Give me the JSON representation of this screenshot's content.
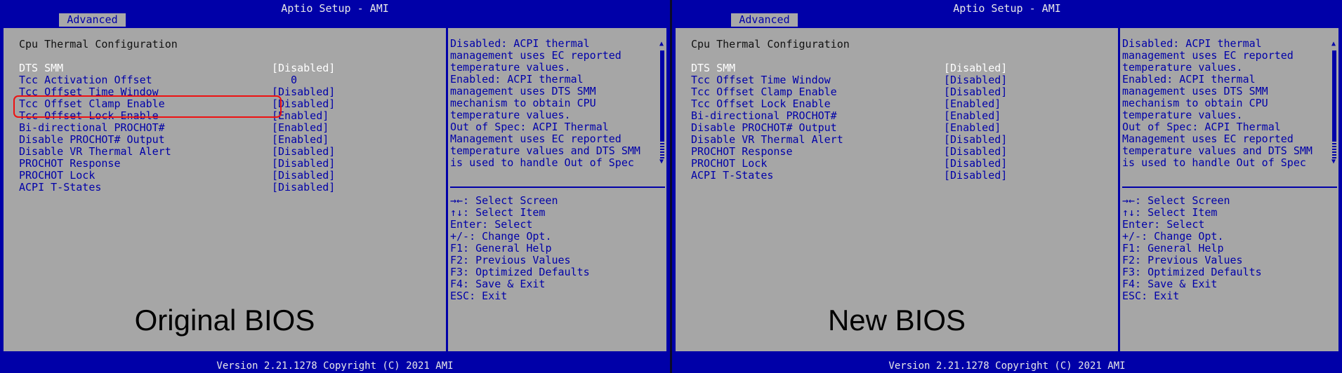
{
  "title": "Aptio Setup - AMI",
  "tab": "Advanced",
  "heading": "Cpu Thermal Configuration",
  "footer": "Version 2.21.1278 Copyright (C) 2021 AMI",
  "help": [
    "Disabled: ACPI thermal",
    "management uses EC reported",
    "temperature values.",
    "Enabled: ACPI thermal",
    "management uses DTS SMM",
    "mechanism to obtain CPU",
    "temperature values.",
    "Out of Spec: ACPI Thermal",
    "Management uses EC reported",
    "temperature values and DTS SMM",
    "is used to handle Out of Spec"
  ],
  "keys": [
    "→←: Select Screen",
    "↑↓: Select Item",
    "Enter: Select",
    "+/-: Change Opt.",
    "F1: General Help",
    "F2: Previous Values",
    "F3: Optimized Defaults",
    "F4: Save & Exit",
    "ESC: Exit"
  ],
  "left": {
    "caption": "Original BIOS",
    "rows": [
      {
        "label": "DTS SMM",
        "value": "[Disabled]"
      },
      {
        "label": "Tcc Activation Offset",
        "value": "0"
      },
      {
        "label": "Tcc Offset Time Window",
        "value": "[Disabled]"
      },
      {
        "label": "Tcc Offset Clamp Enable",
        "value": "[Disabled]"
      },
      {
        "label": "Tcc Offset Lock Enable",
        "value": "[Enabled]"
      },
      {
        "label": "Bi-directional PROCHOT#",
        "value": "[Enabled]"
      },
      {
        "label": "Disable PROCHOT# Output",
        "value": "[Enabled]"
      },
      {
        "label": "Disable VR Thermal Alert",
        "value": "[Disabled]"
      },
      {
        "label": "PROCHOT Response",
        "value": "[Disabled]"
      },
      {
        "label": "PROCHOT Lock",
        "value": "[Disabled]"
      },
      {
        "label": "ACPI T-States",
        "value": "[Disabled]"
      }
    ]
  },
  "right": {
    "caption": "New BIOS",
    "rows": [
      {
        "label": "DTS SMM",
        "value": "[Disabled]"
      },
      {
        "label": "Tcc Offset Time Window",
        "value": "[Disabled]"
      },
      {
        "label": "Tcc Offset Clamp Enable",
        "value": "[Disabled]"
      },
      {
        "label": "Tcc Offset Lock Enable",
        "value": "[Enabled]"
      },
      {
        "label": "Bi-directional PROCHOT#",
        "value": "[Enabled]"
      },
      {
        "label": "Disable PROCHOT# Output",
        "value": "[Enabled]"
      },
      {
        "label": "Disable VR Thermal Alert",
        "value": "[Disabled]"
      },
      {
        "label": "PROCHOT Response",
        "value": "[Disabled]"
      },
      {
        "label": "PROCHOT Lock",
        "value": "[Disabled]"
      },
      {
        "label": "ACPI T-States",
        "value": "[Disabled]"
      }
    ]
  }
}
